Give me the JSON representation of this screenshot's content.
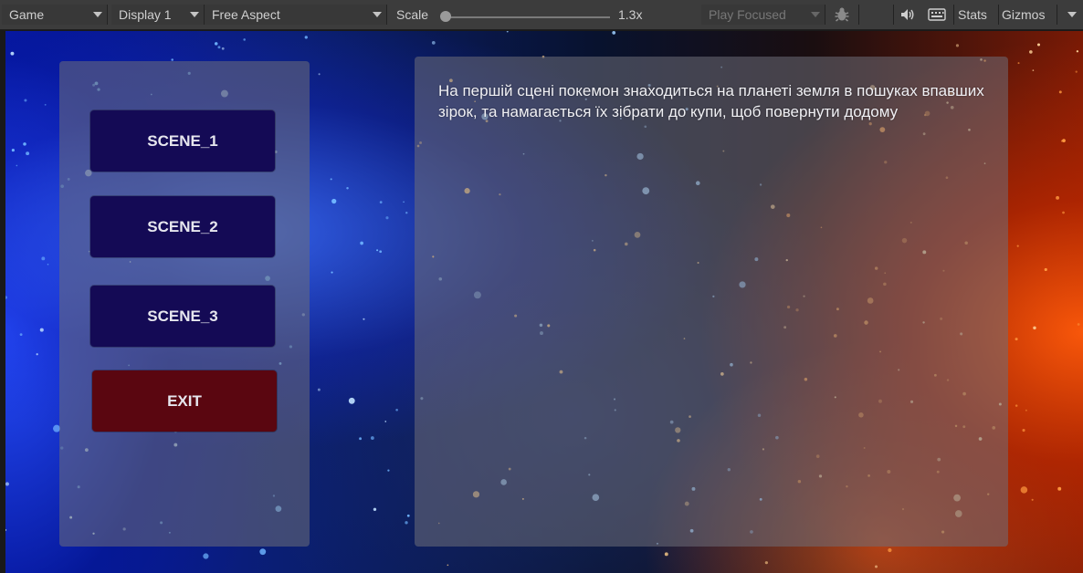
{
  "toolbar": {
    "view_mode": "Game",
    "display": "Display 1",
    "aspect": "Free Aspect",
    "scale_label": "Scale",
    "scale_value": "1.3x",
    "play_mode": "Play Focused",
    "stats_label": "Stats",
    "gizmos_label": "Gizmos",
    "icons": [
      "bug-icon",
      "speaker-icon",
      "keyboard-icon"
    ]
  },
  "menu": {
    "buttons": [
      "SCENE_1",
      "SCENE_2",
      "SCENE_3"
    ],
    "exit_label": "EXIT"
  },
  "info": {
    "text": "На першій сцені покемон знаходиться на планеті земля в пошуках впавших зірок, та намагається їх зібрати до купи, щоб повернути додому"
  },
  "colors": {
    "scene_button": "#140a55",
    "exit_button": "#5a0610",
    "toolbar": "#3c3c3c"
  }
}
